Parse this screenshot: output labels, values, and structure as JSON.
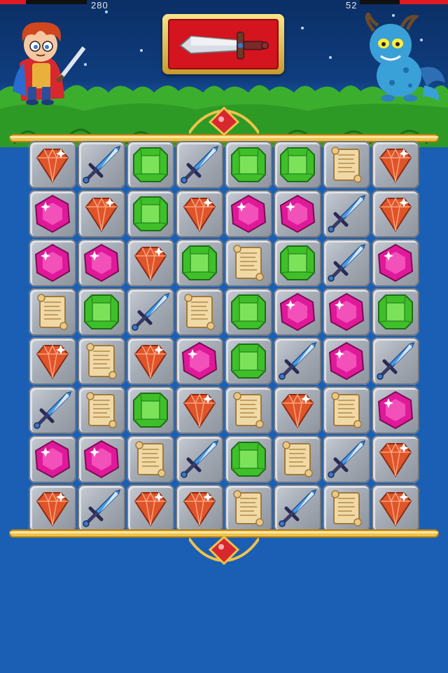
{
  "hud": {
    "player_hp_text": "280",
    "enemy_hp_text": "52",
    "player_hp_fraction": 0.3,
    "enemy_hp_fraction": 0.55,
    "hp_color": "#e01b24"
  },
  "weapon_slot": {
    "icon": "sword-icon"
  },
  "board": {
    "columns": 8,
    "rows": 8,
    "grid": [
      [
        "ruby",
        "sword",
        "emerald",
        "sword",
        "emerald",
        "emerald",
        "scroll",
        "ruby"
      ],
      [
        "amethyst",
        "ruby",
        "emerald",
        "ruby",
        "amethyst",
        "amethyst",
        "sword",
        "ruby"
      ],
      [
        "amethyst",
        "amethyst",
        "ruby",
        "emerald",
        "scroll",
        "emerald",
        "sword",
        "amethyst"
      ],
      [
        "scroll",
        "emerald",
        "sword",
        "scroll",
        "emerald",
        "amethyst",
        "amethyst",
        "emerald"
      ],
      [
        "ruby",
        "scroll",
        "ruby",
        "amethyst",
        "emerald",
        "sword",
        "amethyst",
        "sword"
      ],
      [
        "sword",
        "scroll",
        "emerald",
        "ruby",
        "scroll",
        "ruby",
        "scroll",
        "amethyst"
      ],
      [
        "amethyst",
        "amethyst",
        "scroll",
        "sword",
        "emerald",
        "scroll",
        "sword",
        "ruby"
      ],
      [
        "ruby",
        "sword",
        "ruby",
        "ruby",
        "scroll",
        "sword",
        "scroll",
        "ruby"
      ]
    ]
  },
  "colors": {
    "background": "#1a5fb4",
    "ruby": "#e0542a",
    "amethyst": "#e0199a",
    "emerald": "#3fbf2a",
    "sword": "#4a9be8",
    "scroll": "#f1d9a6",
    "gold": "#f0c24a"
  }
}
